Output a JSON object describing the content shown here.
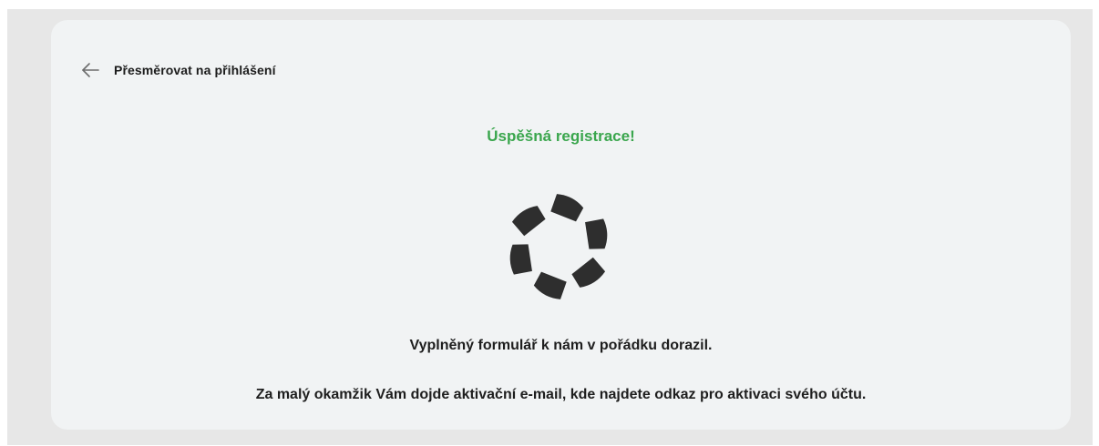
{
  "back_link": {
    "label": "Přesměrovat na přihlášení",
    "icon": "arrow-left-icon"
  },
  "status": {
    "title": "Úspěšná registrace!",
    "title_color": "#3aa64d"
  },
  "spinner": {
    "icon": "loading-spinner-icon",
    "color": "#2e2e2e"
  },
  "messages": [
    "Vyplněný formulář k nám v pořádku dorazil.",
    "Za malý okamžik Vám dojde aktivační e-mail, kde najdete odkaz pro aktivaci svého účtu."
  ]
}
